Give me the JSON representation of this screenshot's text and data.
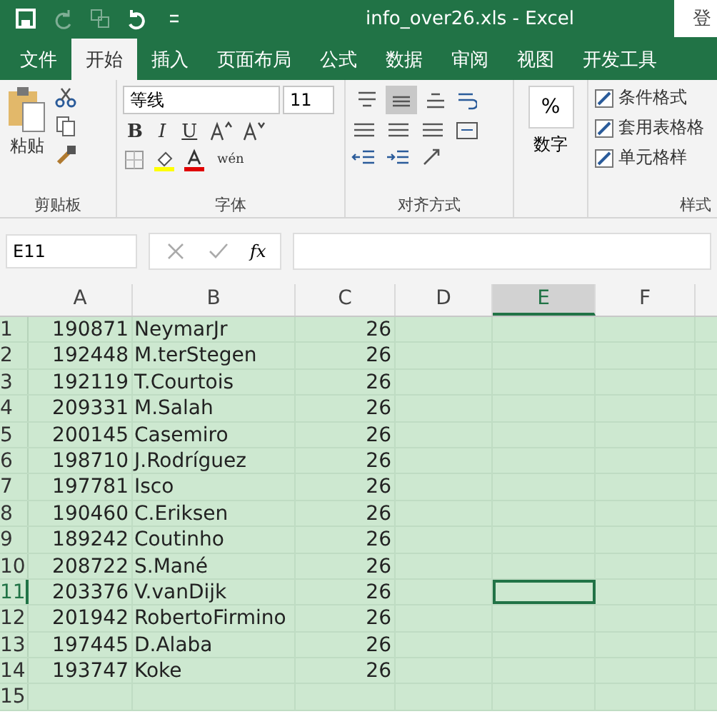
{
  "window": {
    "title": "info_over26.xls  -  Excel",
    "sign_in": "登"
  },
  "tabs": [
    {
      "label": "文件",
      "selected": false
    },
    {
      "label": "开始",
      "selected": true
    },
    {
      "label": "插入",
      "selected": false
    },
    {
      "label": "页面布局",
      "selected": false
    },
    {
      "label": "公式",
      "selected": false
    },
    {
      "label": "数据",
      "selected": false
    },
    {
      "label": "审阅",
      "selected": false
    },
    {
      "label": "视图",
      "selected": false
    },
    {
      "label": "开发工具",
      "selected": false
    }
  ],
  "ribbon": {
    "clipboard": {
      "paste": "粘贴",
      "label": "剪贴板"
    },
    "font": {
      "name": "等线",
      "size": "11",
      "bold": "B",
      "italic": "I",
      "underline": "U",
      "phonetic": "wén",
      "label": "字体"
    },
    "alignment": {
      "buttons": [
        {
          "kind": "top",
          "pressed": false
        },
        {
          "kind": "middle",
          "pressed": true
        },
        {
          "kind": "bottom",
          "pressed": false
        }
      ],
      "label": "对齐方式"
    },
    "number": {
      "symbol": "%",
      "label": "数字"
    },
    "styles": {
      "items": [
        "条件格式",
        "套用表格格",
        "单元格样"
      ],
      "label": "样式"
    }
  },
  "formula_bar": {
    "name_box": "E11",
    "function_label": "fx"
  },
  "sheet": {
    "columns": [
      {
        "label": "A",
        "selected": false
      },
      {
        "label": "B",
        "selected": false
      },
      {
        "label": "C",
        "selected": false
      },
      {
        "label": "D",
        "selected": false
      },
      {
        "label": "E",
        "selected": true
      },
      {
        "label": "F",
        "selected": false
      }
    ],
    "rows": [
      {
        "header": "1",
        "selected": false,
        "cells": [
          "190871",
          "NeymarJr",
          "26"
        ]
      },
      {
        "header": "2",
        "selected": false,
        "cells": [
          "192448",
          "M.terStegen",
          "26"
        ]
      },
      {
        "header": "3",
        "selected": false,
        "cells": [
          "192119",
          "T.Courtois",
          "26"
        ]
      },
      {
        "header": "4",
        "selected": false,
        "cells": [
          "209331",
          "M.Salah",
          "26"
        ]
      },
      {
        "header": "5",
        "selected": false,
        "cells": [
          "200145",
          "Casemiro",
          "26"
        ]
      },
      {
        "header": "6",
        "selected": false,
        "cells": [
          "198710",
          "J.Rodríguez",
          "26"
        ]
      },
      {
        "header": "7",
        "selected": false,
        "cells": [
          "197781",
          "Isco",
          "26"
        ]
      },
      {
        "header": "8",
        "selected": false,
        "cells": [
          "190460",
          "C.Eriksen",
          "26"
        ]
      },
      {
        "header": "9",
        "selected": false,
        "cells": [
          "189242",
          "Coutinho",
          "26"
        ]
      },
      {
        "header": "10",
        "selected": false,
        "cells": [
          "208722",
          "S.Mané",
          "26"
        ]
      },
      {
        "header": "11",
        "selected": true,
        "cells": [
          "203376",
          "V.vanDijk",
          "26"
        ]
      },
      {
        "header": "12",
        "selected": false,
        "cells": [
          "201942",
          "RobertoFirmino",
          "26"
        ]
      },
      {
        "header": "13",
        "selected": false,
        "cells": [
          "197445",
          "D.Alaba",
          "26"
        ]
      },
      {
        "header": "14",
        "selected": false,
        "cells": [
          "193747",
          "Koke",
          "26"
        ]
      },
      {
        "header": "15",
        "selected": false,
        "cells": []
      }
    ]
  }
}
